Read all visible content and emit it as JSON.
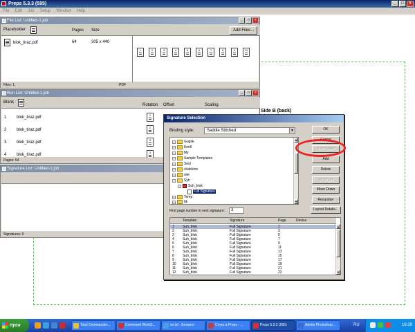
{
  "app": {
    "title": "Preps 5.3.3 (595)"
  },
  "menu": [
    "File",
    "Edit",
    "Job",
    "Setup",
    "Window",
    "Help"
  ],
  "workspace": {
    "side_label": "Side B (back)"
  },
  "file_list": {
    "title": "File List:  Untitled-1.job",
    "placeholder": "Placeholder",
    "col_pages": "Pages",
    "col_size": "Size",
    "add_files": "Add Files...",
    "row": {
      "name": "blok_tiraz.pdf",
      "pages": "64",
      "size": "305 x 440"
    },
    "pages": [
      "1",
      "2",
      "3",
      "4",
      "5",
      "6",
      "7",
      "8",
      "9",
      "10"
    ],
    "status_left": "Files: 1",
    "status_right": "PDF"
  },
  "run_list": {
    "title": "Run List:  Untitled-1.job",
    "blank": "Blank",
    "col_rotation": "Rotation",
    "col_offset": "Offset",
    "col_scaling": "Scaling",
    "rows": [
      {
        "num": "1",
        "name": "blok_tiraz.pdf",
        "page": "1"
      },
      {
        "num": "2",
        "name": "blok_tiraz.pdf",
        "page": "2"
      },
      {
        "num": "3",
        "name": "blok_tiraz.pdf",
        "page": "3"
      },
      {
        "num": "4",
        "name": "blok_tiraz.pdf",
        "page": "4"
      }
    ],
    "status": "Pages: 64"
  },
  "signature_list": {
    "title": "Signature List:  Untitled-1.job",
    "status": "Signatures: 0"
  },
  "dialog": {
    "title": "Signature Selection",
    "binding_label": "Binding style:",
    "binding_value": "Saddle Stitched",
    "tree": [
      {
        "label": "Gugok",
        "type": "folder",
        "expander": "+"
      },
      {
        "label": "Kirrill",
        "type": "folder",
        "expander": "+"
      },
      {
        "label": "My",
        "type": "folder",
        "expander": "+"
      },
      {
        "label": "Sample Templates",
        "type": "folder",
        "expander": "+"
      },
      {
        "label": "Seul",
        "type": "folder",
        "expander": "+"
      },
      {
        "label": "shablons",
        "type": "folder",
        "expander": "+"
      },
      {
        "label": "slet",
        "type": "folder",
        "expander": "+"
      },
      {
        "label": "Syh",
        "type": "folder",
        "expander": "-"
      },
      {
        "label": "Suh_blok",
        "type": "template",
        "expander": "-"
      },
      {
        "label": "Full Signature",
        "type": "signature",
        "expander": ""
      },
      {
        "label": "Temp",
        "type": "folder",
        "expander": "+"
      },
      {
        "label": "ttk",
        "type": "folder",
        "expander": "+"
      }
    ],
    "first_page_label": "First page number in next signature:",
    "first_page_value": "3",
    "buttons": {
      "ok": "OK",
      "cancel": "Cancel",
      "auto_select": "Auto Select",
      "add": "Add",
      "delete": "Delete",
      "move_up": "Move Up",
      "move_down": "Move Down",
      "renumber": "Renumber",
      "layout_details": "Layout Details..."
    },
    "table": {
      "headers": {
        "template": "Template",
        "signature": "Signature",
        "page": "Page",
        "device": "Device"
      },
      "rows": [
        {
          "n": "1",
          "template": "Suh_blok",
          "signature": "Full Signature",
          "page": "1"
        },
        {
          "n": "2",
          "template": "Suh_blok",
          "signature": "Full Signature",
          "page": "3"
        },
        {
          "n": "3",
          "template": "Suh_blok",
          "signature": "Full Signature",
          "page": "5"
        },
        {
          "n": "4",
          "template": "Suh_blok",
          "signature": "Full Signature",
          "page": "7"
        },
        {
          "n": "5",
          "template": "Suh_blok",
          "signature": "Full Signature",
          "page": "9"
        },
        {
          "n": "6",
          "template": "Suh_blok",
          "signature": "Full Signature",
          "page": "11"
        },
        {
          "n": "7",
          "template": "Suh_blok",
          "signature": "Full Signature",
          "page": "13"
        },
        {
          "n": "8",
          "template": "Suh_blok",
          "signature": "Full Signature",
          "page": "15"
        },
        {
          "n": "9",
          "template": "Suh_blok",
          "signature": "Full Signature",
          "page": "17"
        },
        {
          "n": "10",
          "template": "Suh_blok",
          "signature": "Full Signature",
          "page": "19"
        },
        {
          "n": "11",
          "template": "Suh_blok",
          "signature": "Full Signature",
          "page": "21"
        },
        {
          "n": "12",
          "template": "Suh_blok",
          "signature": "Full Signature",
          "page": "23"
        }
      ]
    }
  },
  "taskbar": {
    "start": "пуск",
    "tasks": [
      {
        "label": "Total Commander...",
        "icon_color": "#e8c040"
      },
      {
        "label": "Command WorkS...",
        "icon_color": "#d03030"
      },
      {
        "label": "sn.txt - Блокнот",
        "icon_color": "#4aa0e0"
      },
      {
        "label": "Спуск в Preps - ...",
        "icon_color": "#c04040"
      },
      {
        "label": "Preps 5.3.3 (595)",
        "icon_color": "#d83030"
      },
      {
        "label": "Adobe Photoshop...",
        "icon_color": "#3a6ad0"
      }
    ],
    "lang": "RU",
    "clock": "16:28"
  }
}
